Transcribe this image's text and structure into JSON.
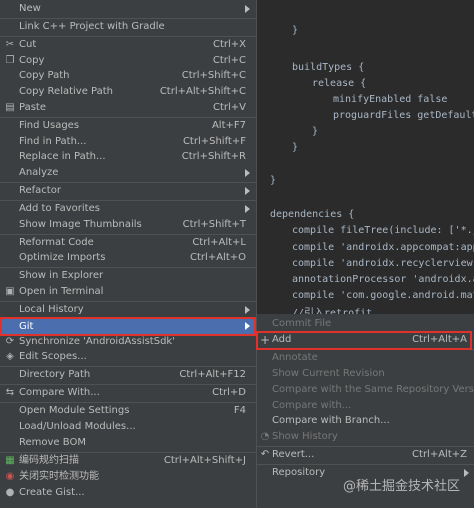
{
  "editor": {
    "lines": [
      {
        "text": "}",
        "indent": 2
      },
      {
        "text": "buildTypes {",
        "indent": 2
      },
      {
        "text": "release {",
        "indent": 4
      },
      {
        "text": "minifyEnabled false",
        "indent": 6
      },
      {
        "text": "proguardFiles getDefaultPro",
        "indent": 6
      },
      {
        "text": "}",
        "indent": 4
      },
      {
        "text": "}",
        "indent": 2
      },
      {
        "text": "}",
        "indent": 0
      },
      {
        "text": "dependencies {",
        "indent": 0
      },
      {
        "text": "compile fileTree(include: ['*.jar']",
        "indent": 2
      },
      {
        "text": "compile 'androidx.appcompat:appcomp",
        "indent": 2
      },
      {
        "text": "compile 'androidx.recyclerview:recy",
        "indent": 2
      },
      {
        "text": "annotationProcessor 'androidx.annot",
        "indent": 2
      },
      {
        "text": "compile 'com.google.android.materia",
        "indent": 2
      },
      {
        "text": "//引入retrofit",
        "indent": 2
      }
    ]
  },
  "menu": {
    "new": "New",
    "link_cpp": "Link C++ Project with Gradle",
    "cut": "Cut",
    "cut_sc": "Ctrl+X",
    "copy": "Copy",
    "copy_sc": "Ctrl+C",
    "copy_path": "Copy Path",
    "copy_path_sc": "Ctrl+Shift+C",
    "copy_rel_path": "Copy Relative Path",
    "copy_rel_path_sc": "Ctrl+Alt+Shift+C",
    "paste": "Paste",
    "paste_sc": "Ctrl+V",
    "find_usages": "Find Usages",
    "find_usages_sc": "Alt+F7",
    "find_in_path": "Find in Path...",
    "find_in_path_sc": "Ctrl+Shift+F",
    "replace_in_path": "Replace in Path...",
    "replace_in_path_sc": "Ctrl+Shift+R",
    "analyze": "Analyze",
    "refactor": "Refactor",
    "add_favorites": "Add to Favorites",
    "show_thumbnails": "Show Image Thumbnails",
    "show_thumbnails_sc": "Ctrl+Shift+T",
    "reformat": "Reformat Code",
    "reformat_sc": "Ctrl+Alt+L",
    "optimize_imports": "Optimize Imports",
    "optimize_imports_sc": "Ctrl+Alt+O",
    "show_explorer": "Show in Explorer",
    "open_terminal": "Open in Terminal",
    "local_history": "Local History",
    "git": "Git",
    "synchronize": "Synchronize 'AndroidAssistSdk'",
    "edit_scopes": "Edit Scopes...",
    "directory_path": "Directory Path",
    "directory_path_sc": "Ctrl+Alt+F12",
    "compare_with": "Compare With...",
    "compare_with_sc": "Ctrl+D",
    "open_module_settings": "Open Module Settings",
    "open_module_settings_sc": "F4",
    "load_unload": "Load/Unload Modules...",
    "remove_bom": "Remove BOM",
    "coding_scan": "编码规约扫描",
    "coding_scan_sc": "Ctrl+Alt+Shift+J",
    "realtime_check": "关闭实时检测功能",
    "create_gist": "Create Gist..."
  },
  "git_menu": {
    "commit_file": "Commit File",
    "add": "Add",
    "add_sc": "Ctrl+Alt+A",
    "annotate": "Annotate",
    "show_current_revision": "Show Current Revision",
    "compare_same_repo": "Compare with the Same Repository Version",
    "compare_with": "Compare with...",
    "compare_branch": "Compare with Branch...",
    "show_history": "Show History",
    "revert": "Revert...",
    "revert_sc": "Ctrl+Alt+Z",
    "repository": "Repository"
  },
  "watermark": "@稀土掘金技术社区",
  "colors": {
    "accent": "#4b6eaf",
    "highlight_border": "#e0312b",
    "menu_bg": "#3c3f41"
  }
}
